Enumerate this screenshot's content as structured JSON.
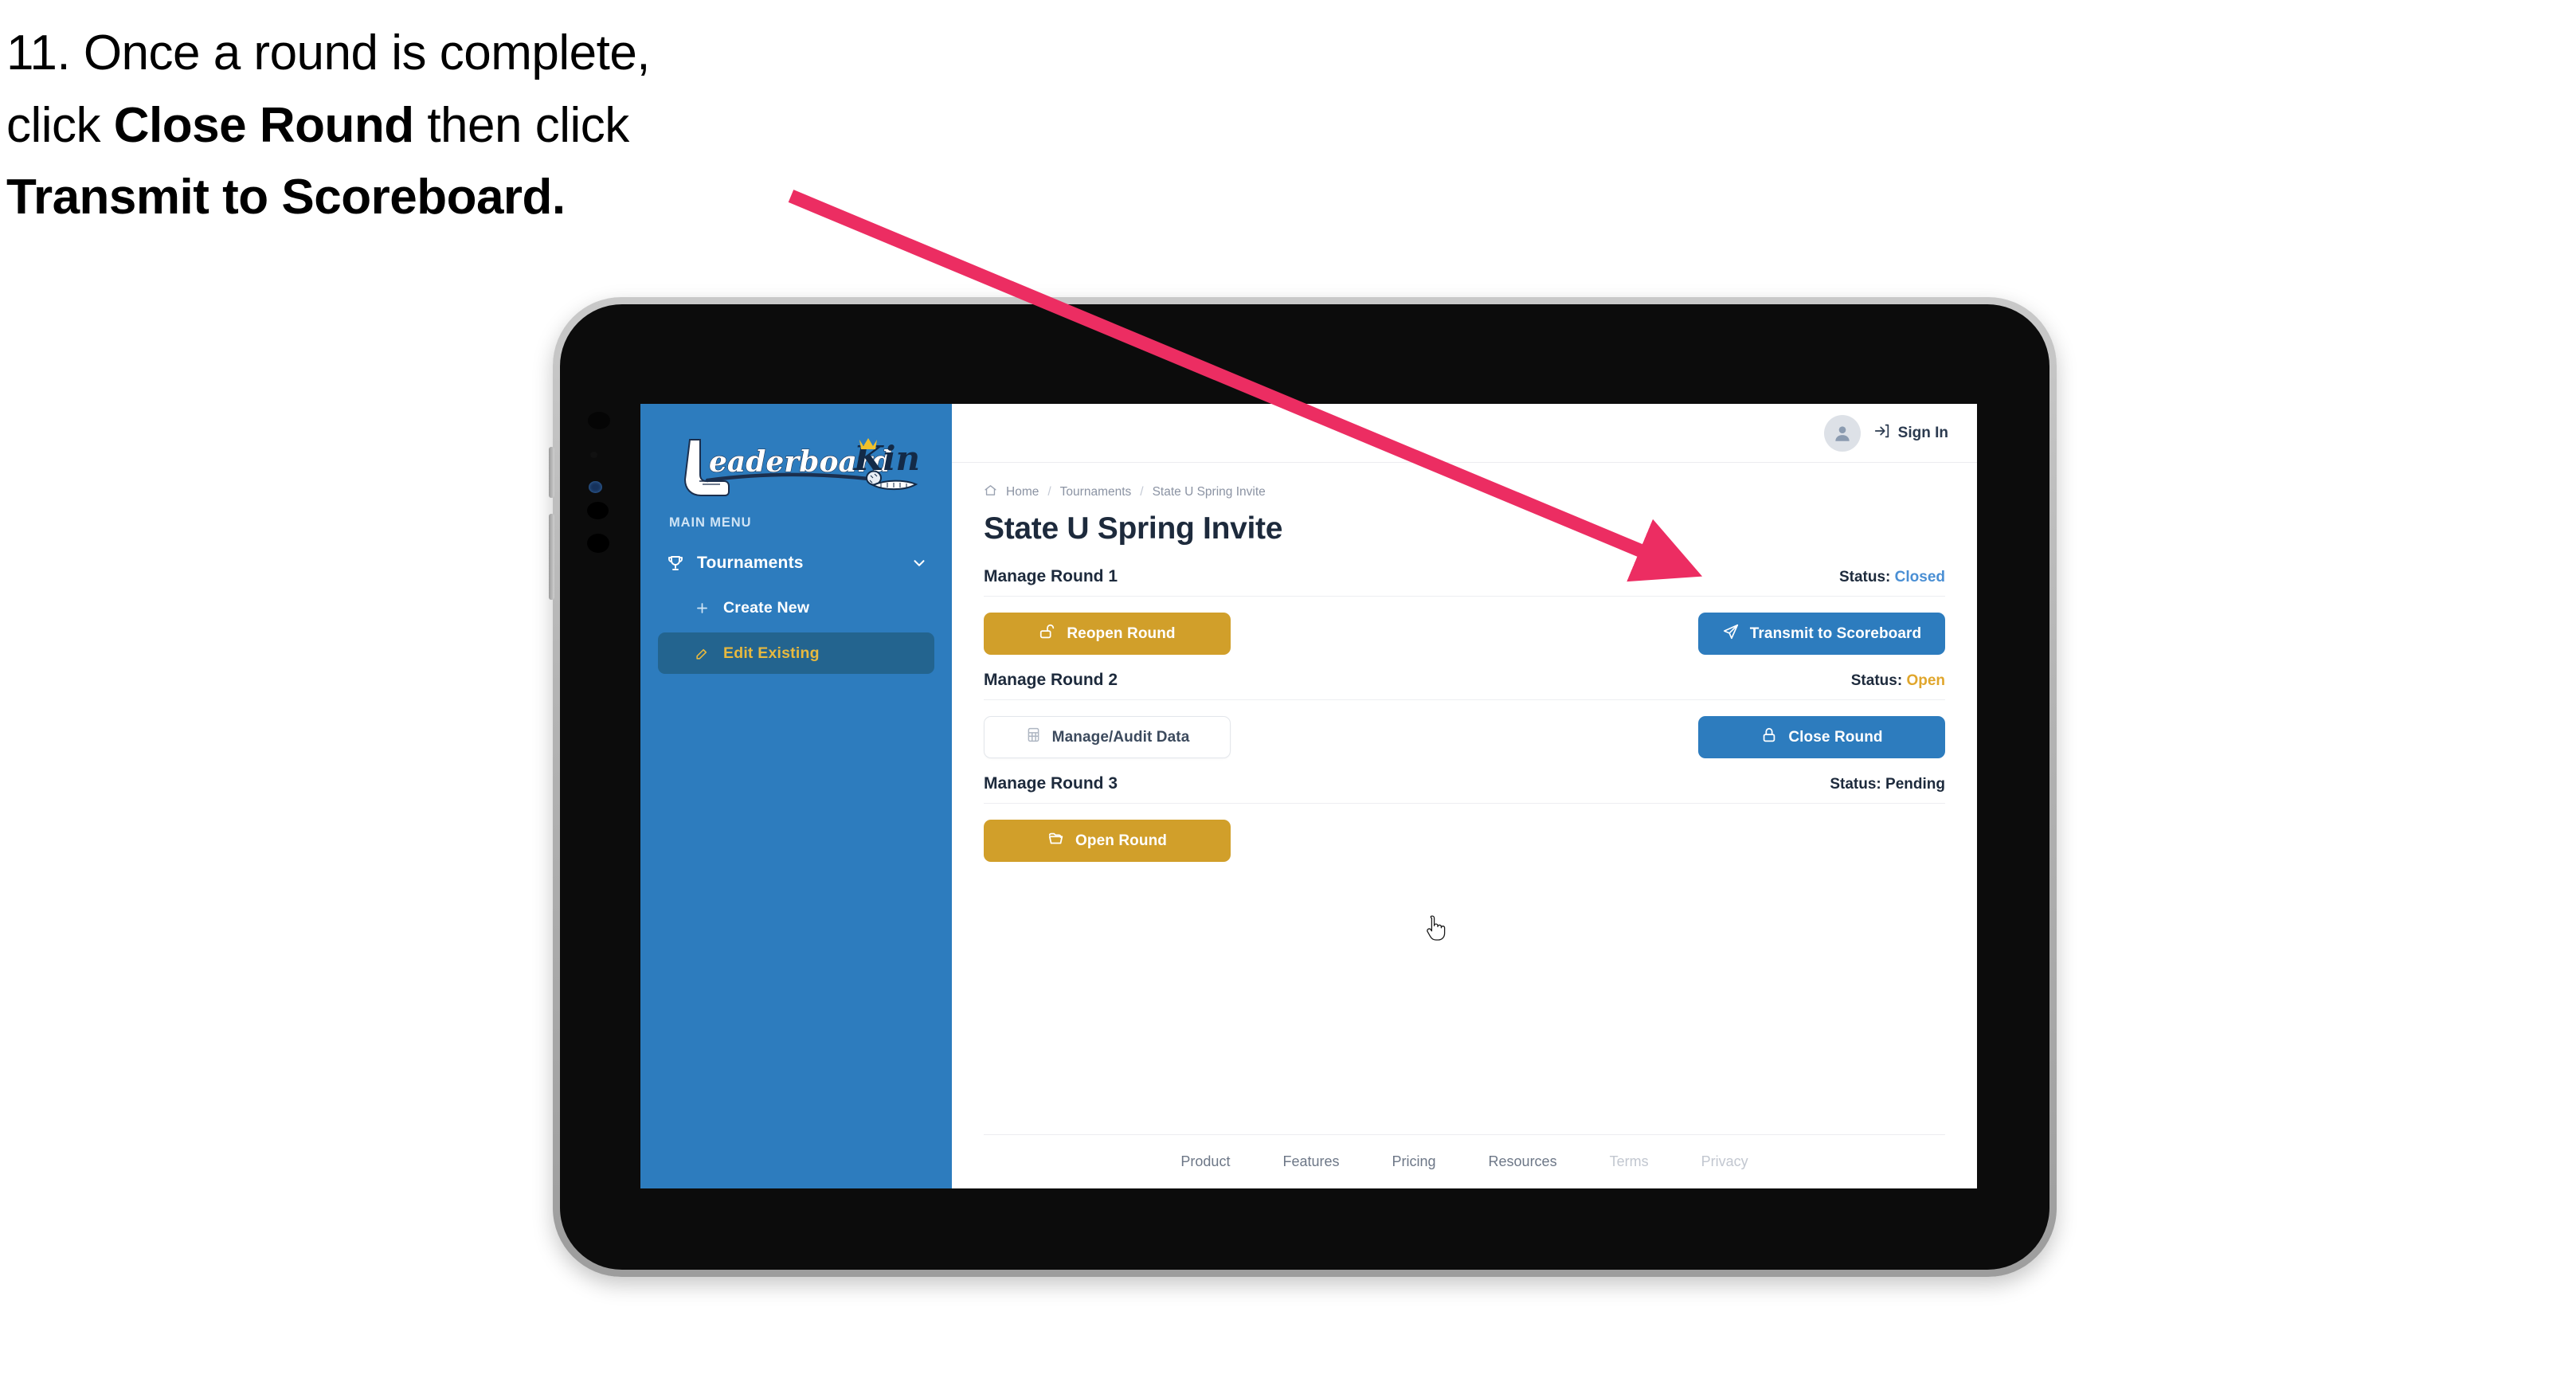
{
  "caption": {
    "line1_prefix": "11. Once a round is complete,",
    "line2_prefix": "click ",
    "line2_bold": "Close Round",
    "line2_suffix": " then click",
    "line3_bold": "Transmit to Scoreboard.",
    "arrow_color": "#ec2d62"
  },
  "sidebar": {
    "logo": {
      "word_script": "Leaderboard",
      "word_block": "King",
      "alt": "LeaderboardKing"
    },
    "section_label": "MAIN MENU",
    "nav": {
      "label": "Tournaments",
      "icon": "trophy-icon",
      "chevron": "chevron-down-icon"
    },
    "sub_items": [
      {
        "label": "Create New",
        "icon": "plus-icon",
        "active": false
      },
      {
        "label": "Edit Existing",
        "icon": "edit-pencil-icon",
        "active": true
      }
    ],
    "background_color": "#2d7cbe",
    "active_item_color": "#23648f",
    "active_text_color": "#e7b93f"
  },
  "topbar": {
    "avatar_icon": "user-avatar-icon",
    "signin_icon": "sign-in-arrow-icon",
    "signin_label": "Sign In"
  },
  "breadcrumb": {
    "home_icon": "home-icon",
    "items": [
      "Home",
      "Tournaments",
      "State U Spring Invite"
    ],
    "separator": "/"
  },
  "page": {
    "title": "State U Spring Invite"
  },
  "rounds": [
    {
      "name": "Manage Round 1",
      "status_label": "Status:",
      "status_value": "Closed",
      "status_kind": "closed",
      "left_button": {
        "label": "Reopen Round",
        "icon": "unlock-icon",
        "style": "gold"
      },
      "right_button": {
        "label": "Transmit to Scoreboard",
        "icon": "paper-plane-icon",
        "style": "blue"
      }
    },
    {
      "name": "Manage Round 2",
      "status_label": "Status:",
      "status_value": "Open",
      "status_kind": "open",
      "left_button": {
        "label": "Manage/Audit Data",
        "icon": "table-grid-icon",
        "style": "ghost"
      },
      "right_button": {
        "label": "Close Round",
        "icon": "lock-icon",
        "style": "blue"
      }
    },
    {
      "name": "Manage Round 3",
      "status_label": "Status:",
      "status_value": "Pending",
      "status_kind": "pending",
      "left_button": {
        "label": "Open Round",
        "icon": "open-folder-icon",
        "style": "gold"
      },
      "right_button": null
    }
  ],
  "footer": {
    "links": [
      {
        "label": "Product",
        "muted": false
      },
      {
        "label": "Features",
        "muted": false
      },
      {
        "label": "Pricing",
        "muted": false
      },
      {
        "label": "Resources",
        "muted": false
      },
      {
        "label": "Terms",
        "muted": true
      },
      {
        "label": "Privacy",
        "muted": true
      }
    ]
  },
  "colors": {
    "brand_blue": "#2d7cbe",
    "gold": "#d19f2a",
    "status_closed": "#4a8fd4",
    "status_open": "#e0a62c",
    "text_dark": "#1d2a3c"
  }
}
